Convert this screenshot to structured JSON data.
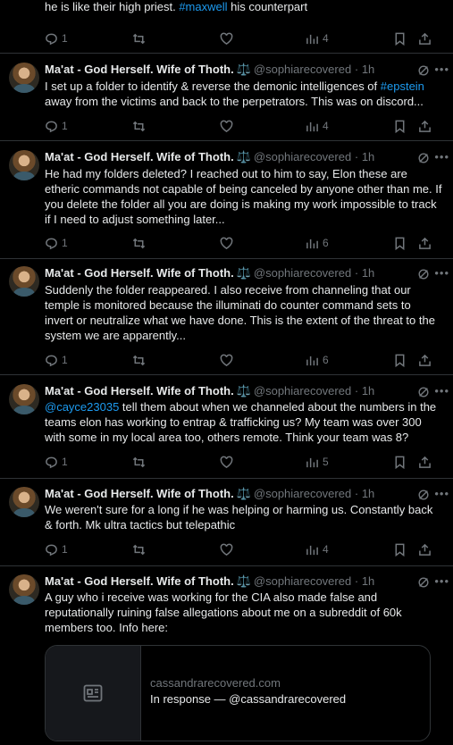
{
  "top_post": {
    "text_partial": "and he isn't dead. That's certain. They need him too for their ritual inversions, he is like their high priest.",
    "hashtag": "#maxwell",
    "text_after": " his counterpart",
    "replies": "1",
    "views": "4"
  },
  "author": {
    "name": "Ma'at - God Herself. Wife of Thoth.",
    "scale_glyph": "⚖️",
    "handle": "@sophiarecovered",
    "dot": "·",
    "time": "1h"
  },
  "posts": [
    {
      "text_before": "I set up a folder to identify & reverse the demonic intelligences of ",
      "hashtag": "#epstein",
      "text_after": " away from the victims and back to the perpetrators.  This was on discord...",
      "replies": "1",
      "views": "4"
    },
    {
      "text": "He had my folders deleted? I reached out to him to say, Elon these are etheric commands not capable of being canceled by anyone other than me. If you delete the folder all you are doing is making my work impossible to track if I need to adjust something later...",
      "replies": "1",
      "views": "6"
    },
    {
      "text": "Suddenly the folder reappeared.  I also receive from channeling that our temple is monitored because the illuminati do counter command sets to invert or neutralize what we have done.  This is the extent of the threat to the system we are apparently...",
      "replies": "1",
      "views": "6"
    },
    {
      "mention": "@cayce23035",
      "text_after": " tell them about when we channeled about the numbers in the teams elon has working to entrap & trafficking us? My team was over 300 with some in my local area too, others remote.  Think your team was 8?",
      "replies": "1",
      "views": "5"
    },
    {
      "text": "We weren't sure for a long if he was helping or harming us. Constantly back & forth.  Mk ultra tactics but telepathic",
      "replies": "1",
      "views": "4"
    },
    {
      "text": "A guy who i receive was working for the CIA also made false and reputationally ruining false allegations about me on a subreddit of 60k members too. Info here:",
      "card": {
        "domain": "cassandrarecovered.com",
        "title": "In response — @cassandrarecovered"
      }
    }
  ],
  "colors": {
    "background": "#000000",
    "text": "#e7e9ea",
    "muted": "#71767b",
    "link": "#1d9bf0",
    "divider": "#2f3336"
  }
}
